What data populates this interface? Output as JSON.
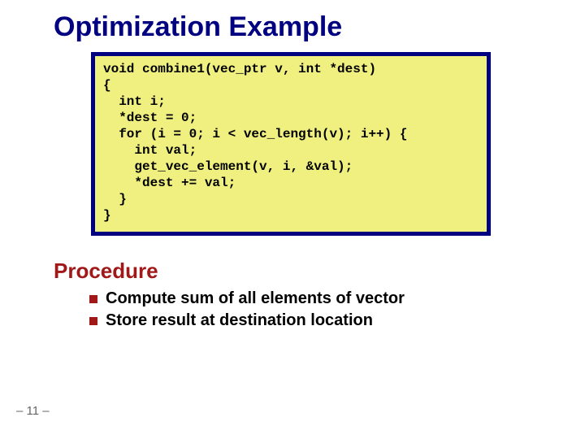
{
  "title": "Optimization Example",
  "code": "void combine1(vec_ptr v, int *dest)\n{\n  int i;\n  *dest = 0;\n  for (i = 0; i < vec_length(v); i++) {\n    int val;\n    get_vec_element(v, i, &val);\n    *dest += val;\n  }\n}",
  "section_heading": "Procedure",
  "bullets": [
    "Compute sum of all elements of vector",
    "Store result at destination location"
  ],
  "page_number": "– 11 –"
}
